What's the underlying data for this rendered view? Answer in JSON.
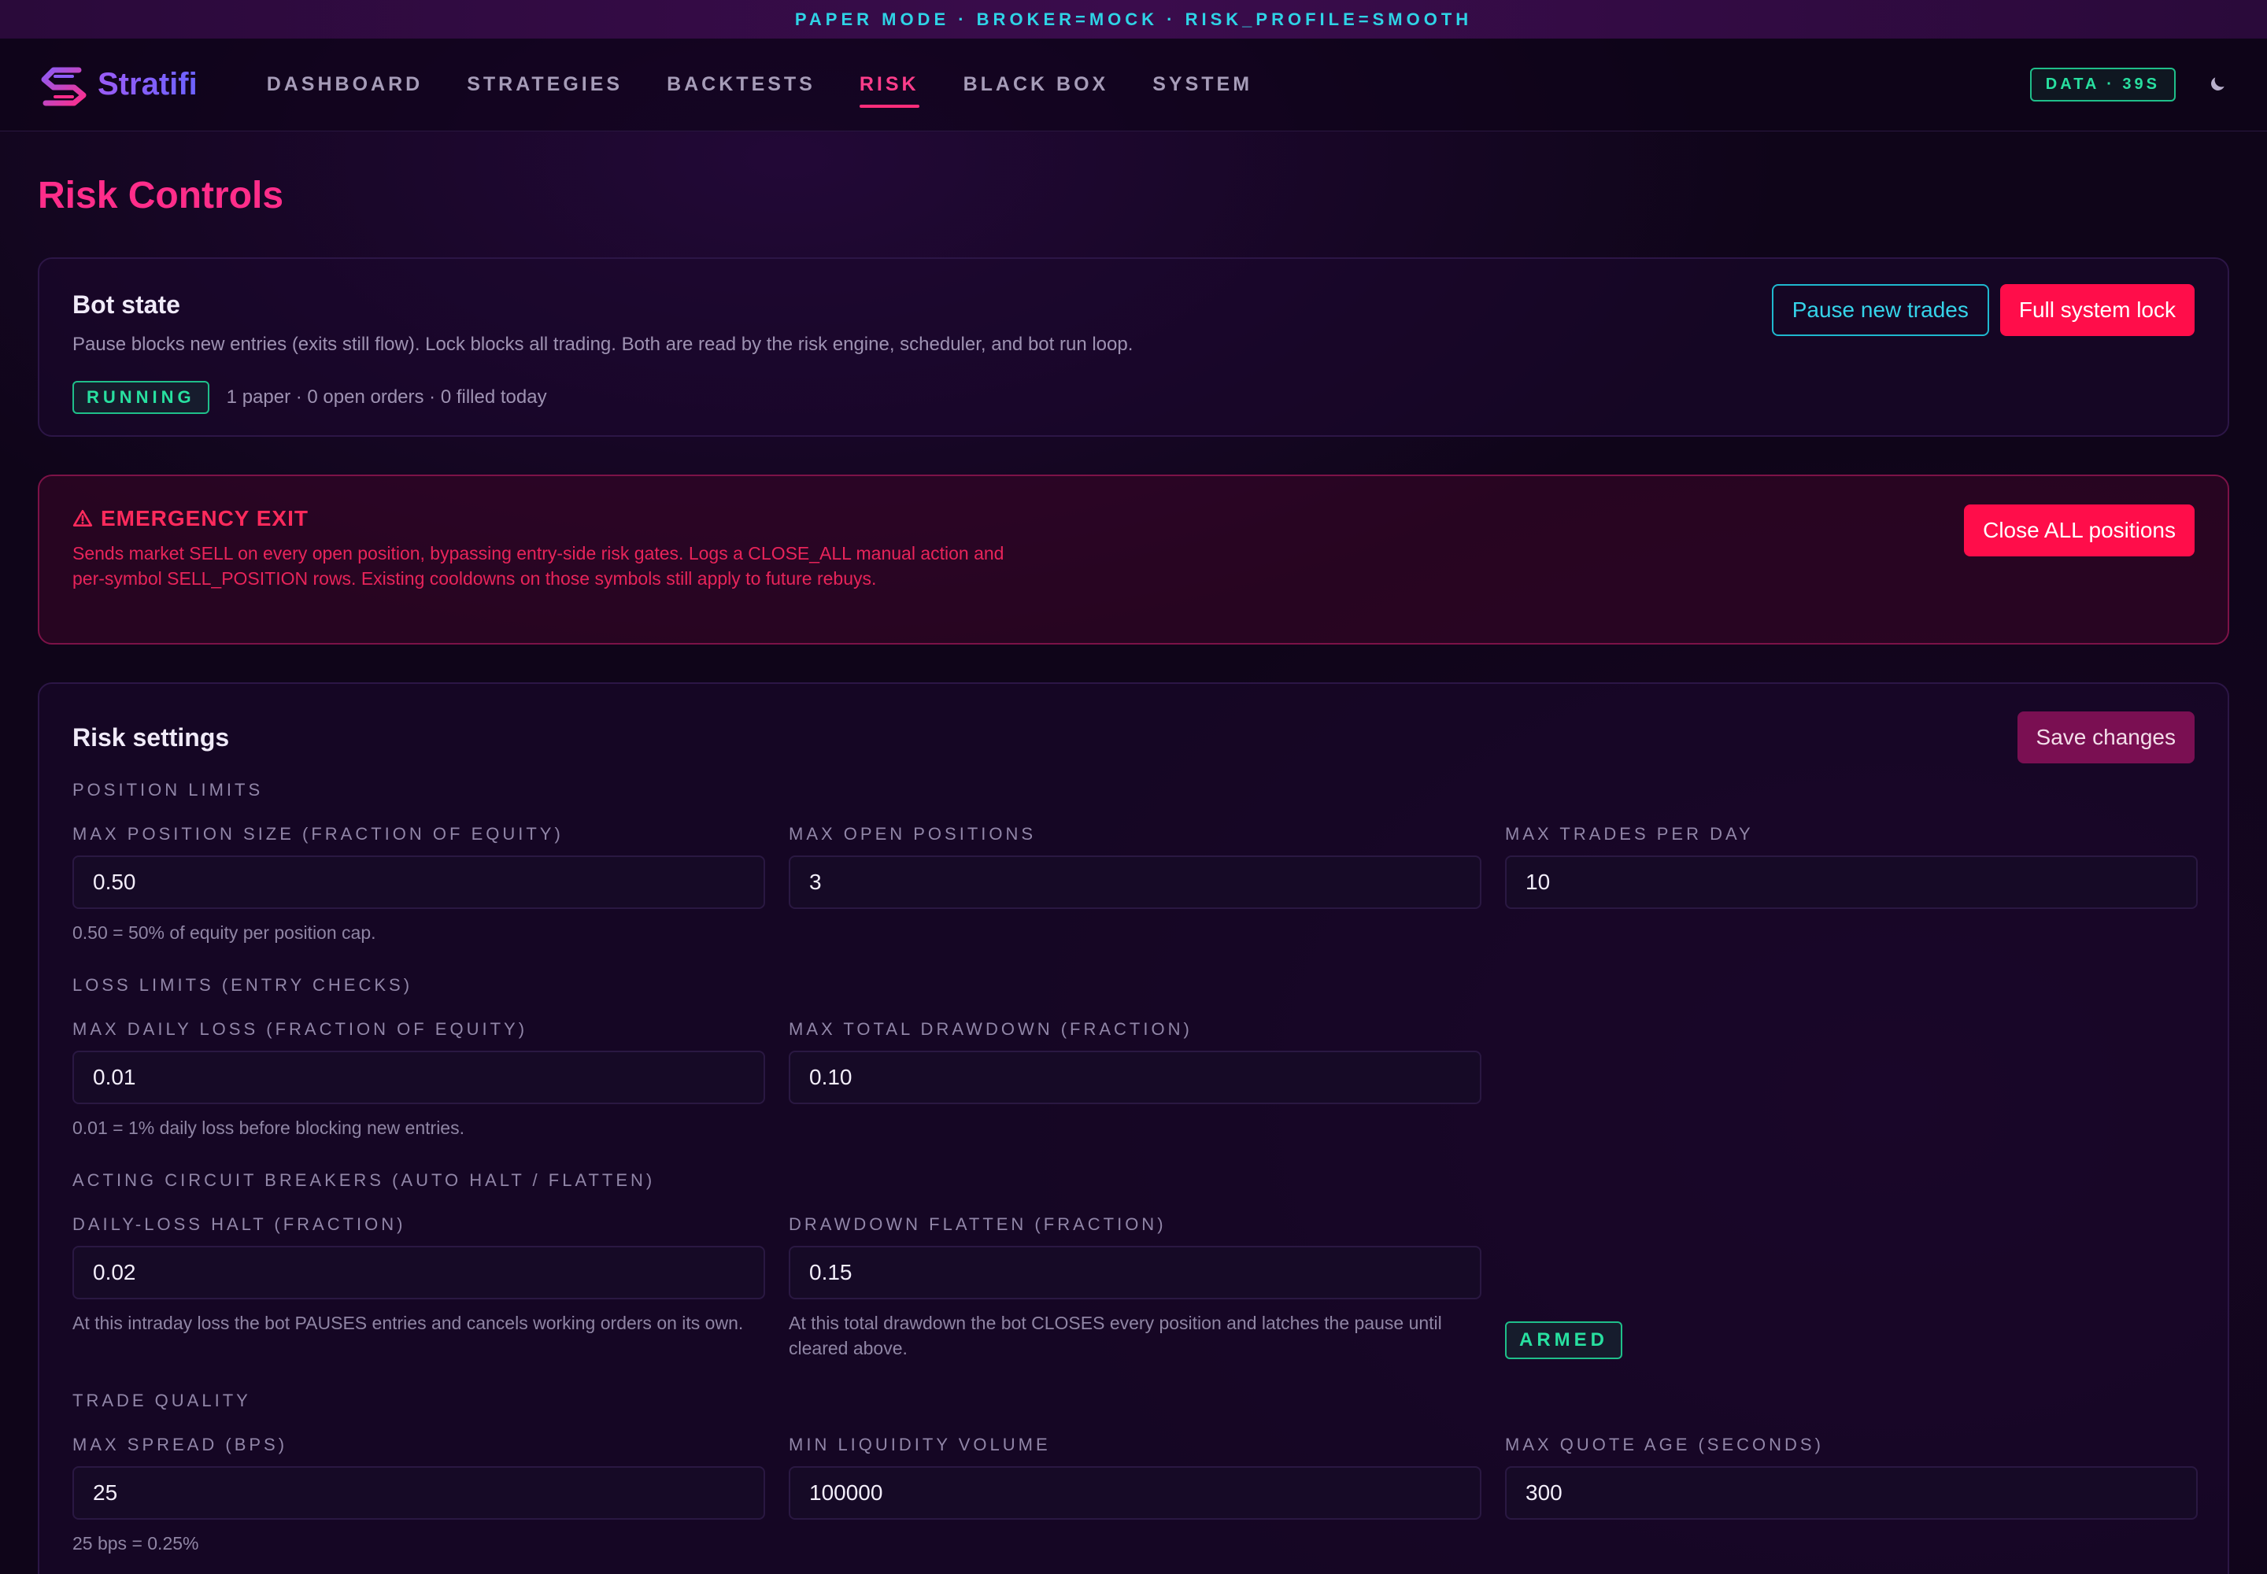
{
  "banner": "PAPER MODE · BROKER=MOCK · RISK_PROFILE=SMOOTH",
  "app": {
    "name": "Stratifi",
    "logo_icon": "stratifi-logo-icon"
  },
  "nav": {
    "items": [
      {
        "label": "DASHBOARD"
      },
      {
        "label": "STRATEGIES"
      },
      {
        "label": "BACKTESTS"
      },
      {
        "label": "RISK",
        "active": true
      },
      {
        "label": "BLACK BOX"
      },
      {
        "label": "SYSTEM"
      }
    ],
    "data_badge": "DATA · 39S",
    "theme_icon": "moon-icon"
  },
  "page": {
    "title": "Risk Controls"
  },
  "bot_state": {
    "title": "Bot state",
    "description": "Pause blocks new entries (exits still flow). Lock blocks all trading. Both are read by the risk engine, scheduler, and bot run loop.",
    "status": "RUNNING",
    "status_detail": "1 paper · 0 open orders · 0 filled today",
    "pause_button": "Pause new trades",
    "lock_button": "Full system lock"
  },
  "emergency": {
    "icon": "warning-icon",
    "title": "EMERGENCY EXIT",
    "description": "Sends market SELL on every open position, bypassing entry-side risk gates. Logs a CLOSE_ALL manual action and per-symbol SELL_POSITION rows. Existing cooldowns on those symbols still apply to future rebuys.",
    "button": "Close ALL positions"
  },
  "risk_settings": {
    "title": "Risk settings",
    "save_button": "Save changes",
    "sections": {
      "position_limits": {
        "label": "POSITION LIMITS",
        "max_position_size": {
          "label": "MAX POSITION SIZE (FRACTION OF EQUITY)",
          "value": "0.50",
          "hint": "0.50 = 50% of equity per position cap."
        },
        "max_open_positions": {
          "label": "MAX OPEN POSITIONS",
          "value": "3"
        },
        "max_trades_per_day": {
          "label": "MAX TRADES PER DAY",
          "value": "10"
        }
      },
      "loss_limits": {
        "label": "LOSS LIMITS (ENTRY CHECKS)",
        "max_daily_loss": {
          "label": "MAX DAILY LOSS (FRACTION OF EQUITY)",
          "value": "0.01",
          "hint": "0.01 = 1% daily loss before blocking new entries."
        },
        "max_total_drawdown": {
          "label": "MAX TOTAL DRAWDOWN (FRACTION)",
          "value": "0.10"
        }
      },
      "circuit_breakers": {
        "label": "ACTING CIRCUIT BREAKERS (AUTO HALT / FLATTEN)",
        "daily_loss_halt": {
          "label": "DAILY-LOSS HALT (FRACTION)",
          "value": "0.02",
          "hint": "At this intraday loss the bot PAUSES entries and cancels working orders on its own."
        },
        "drawdown_flatten": {
          "label": "DRAWDOWN FLATTEN (FRACTION)",
          "value": "0.15",
          "hint": "At this total drawdown the bot CLOSES every position and latches the pause until cleared above."
        },
        "status": "ARMED"
      },
      "trade_quality": {
        "label": "TRADE QUALITY",
        "max_spread": {
          "label": "MAX SPREAD (BPS)",
          "value": "25",
          "hint": "25 bps = 0.25%"
        },
        "min_liquidity": {
          "label": "MIN LIQUIDITY VOLUME",
          "value": "100000"
        },
        "max_quote_age": {
          "label": "MAX QUOTE AGE (SECONDS)",
          "value": "300"
        }
      }
    }
  },
  "colors": {
    "accent_pink": "#ff2d8a",
    "accent_cyan": "#2fd3e6",
    "status_green": "#28e0a0",
    "danger_red": "#ff0d4a",
    "background": "#0f0519"
  }
}
